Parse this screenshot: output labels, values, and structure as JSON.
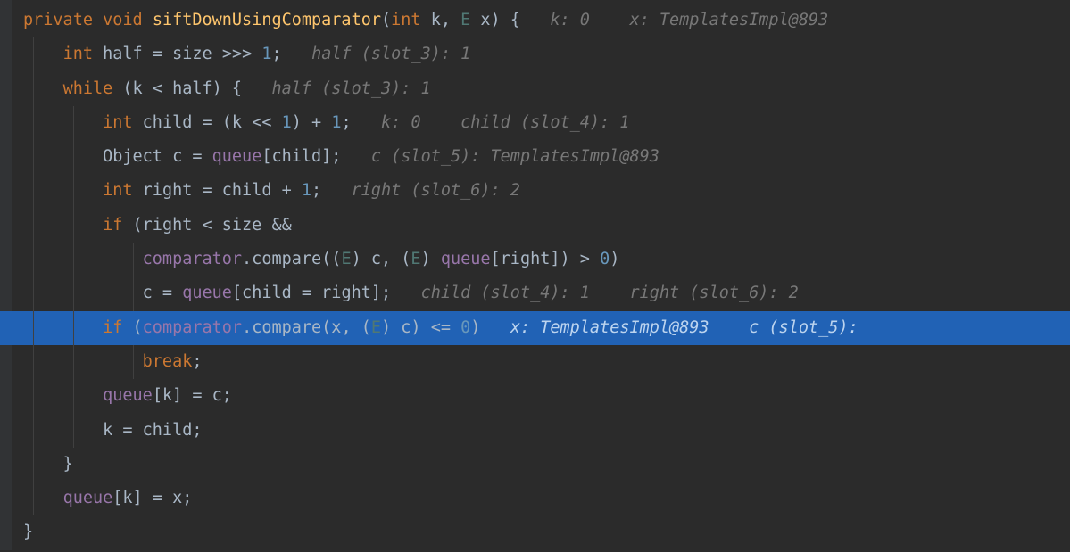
{
  "colors": {
    "bg": "#2b2b2b",
    "highlight": "#2162b5",
    "keyword": "#cc7832",
    "function": "#ffc66d",
    "number": "#6897bb",
    "field": "#9876aa",
    "generic": "#507874",
    "text": "#a9b7c6",
    "hint": "#787878"
  },
  "code": {
    "l0": {
      "kw1": "private",
      "kw2": "void",
      "fn": "siftDownUsingComparator",
      "p1t": "int",
      "p1n": "k",
      "p2t": "E",
      "p2n": "x",
      "hint": "k: 0    x: TemplatesImpl@893"
    },
    "l1": {
      "kw": "int",
      "var": "half",
      "eq": "=",
      "expr1": "size",
      "op": ">>>",
      "num": "1",
      "hint": "half (slot_3): 1"
    },
    "l2": {
      "kw": "while",
      "cond": "(k < half) {",
      "hint": "half (slot_3): 1"
    },
    "l3": {
      "kw": "int",
      "var": "child",
      "eq": "= (k <<",
      "num1": "1",
      "mid": ") +",
      "num2": "1",
      "end": ";",
      "hint": "k: 0    child (slot_4): 1"
    },
    "l4": {
      "type": "Object",
      "var": "c =",
      "field": "queue",
      "idx": "[child];",
      "hint": "c (slot_5): TemplatesImpl@893"
    },
    "l5": {
      "kw": "int",
      "var": "right = child +",
      "num": "1",
      "end": ";",
      "hint": "right (slot_6): 2"
    },
    "l6": {
      "kw": "if",
      "cond": "(right < size &&"
    },
    "l7": {
      "field": "comparator",
      "call": ".compare((",
      "gen1": "E",
      "mid1": ") c, (",
      "gen2": "E",
      "mid2": ")",
      "field2": "queue",
      "end": "[right]) >",
      "num": "0",
      "paren": ")"
    },
    "l8": {
      "lhs": "c =",
      "field": "queue",
      "mid": "[child = right];",
      "hint": "child (slot_4): 1    right (slot_6): 2"
    },
    "l9": {
      "kw": "if",
      "op1": "(",
      "field": "comparator",
      "call": ".compare(x, (",
      "gen": "E",
      "rest": ") c) <=",
      "num": "0",
      "paren": ")",
      "hint": "x: TemplatesImpl@893    c (slot_5):"
    },
    "l10": {
      "kw": "break",
      "end": ";"
    },
    "l11": {
      "field": "queue",
      "rest": "[k] = c;"
    },
    "l12": {
      "stmt": "k = child;"
    },
    "l13": {
      "brace": "}"
    },
    "l14": {
      "field": "queue",
      "rest": "[k] = x;"
    },
    "l15": {
      "brace": "}"
    }
  }
}
